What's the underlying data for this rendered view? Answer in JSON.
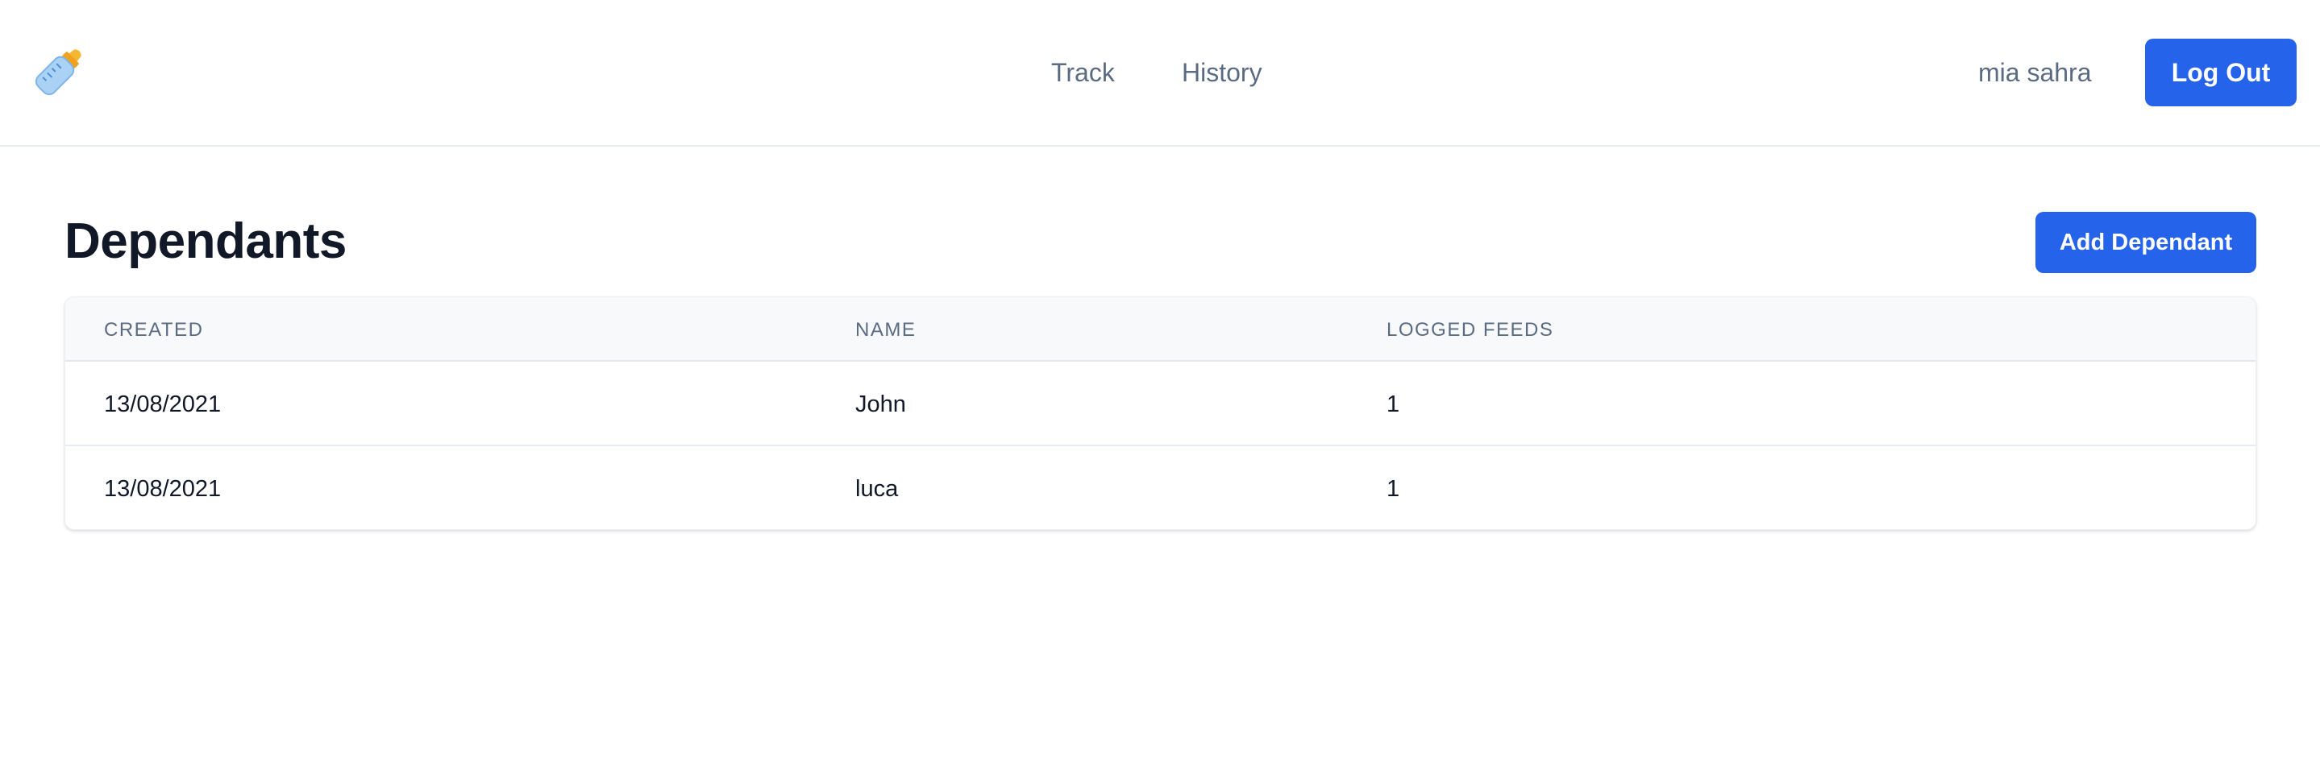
{
  "header": {
    "logo_icon": "baby-bottle-icon",
    "nav": [
      {
        "label": "Track"
      },
      {
        "label": "History"
      }
    ],
    "user_name": "mia sahra",
    "logout_label": "Log Out"
  },
  "main": {
    "title": "Dependants",
    "add_button_label": "Add Dependant",
    "table": {
      "columns": [
        "CREATED",
        "NAME",
        "LOGGED FEEDS"
      ],
      "rows": [
        {
          "created": "13/08/2021",
          "name": "John",
          "logged_feeds": "1"
        },
        {
          "created": "13/08/2021",
          "name": "luca",
          "logged_feeds": "1"
        }
      ]
    }
  },
  "colors": {
    "accent": "#2563eb",
    "muted_text": "#5b6b82",
    "heading": "#111827"
  }
}
